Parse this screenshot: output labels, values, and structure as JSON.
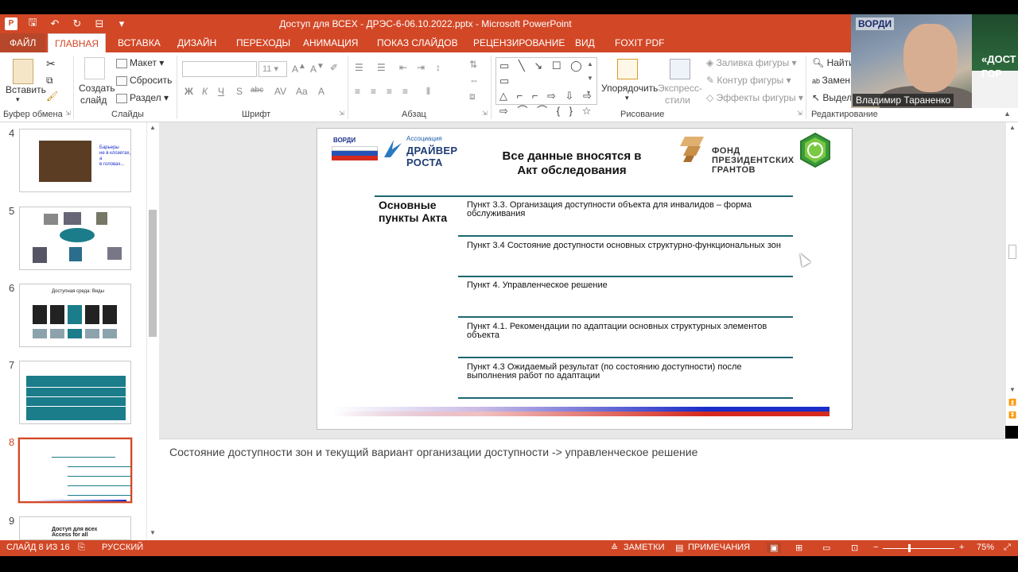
{
  "window": {
    "title": "Доступ для ВСЕХ - ДРЭС-6-06.10.2022.pptx - Microsoft PowerPoint",
    "app_logo": "P"
  },
  "quick_access": {
    "save_icon": "save-icon",
    "undo_icon": "undo-icon",
    "redo_icon": "redo-icon"
  },
  "tabs": [
    {
      "label": "ФАЙЛ"
    },
    {
      "label": "ГЛАВНАЯ"
    },
    {
      "label": "ВСТАВКА"
    },
    {
      "label": "ДИЗАЙН"
    },
    {
      "label": "ПЕРЕХОДЫ"
    },
    {
      "label": "АНИМАЦИЯ"
    },
    {
      "label": "ПОКАЗ СЛАЙДОВ"
    },
    {
      "label": "РЕЦЕНЗИРОВАНИЕ"
    },
    {
      "label": "ВИД"
    },
    {
      "label": "FOXIT PDF"
    }
  ],
  "ribbon": {
    "clipboard": {
      "paste": "Вставить",
      "label": "Буфер обмена"
    },
    "slides": {
      "new_slide_1": "Создать",
      "new_slide_2": "слайд",
      "layout": "Макет",
      "reset": "Сбросить",
      "section": "Раздел",
      "label": "Слайды"
    },
    "font": {
      "size": "11",
      "bold": "Ж",
      "italic": "К",
      "underline": "Ч",
      "strike": "S",
      "abc": "abc",
      "label": "Шрифт"
    },
    "paragraph": {
      "label": "Абзац"
    },
    "drawing": {
      "arrange": "Упорядочить",
      "quick_styles_1": "Экспресс-",
      "quick_styles_2": "стили",
      "fill": "Заливка фигуры",
      "outline": "Контур фигуры",
      "effects": "Эффекты фигуры",
      "label": "Рисование",
      "shapes_row1": "▭ ╲ ↘ ☐ ◯ ▭",
      "shapes_row2": "△ ⌐ ⌐ ⇨ ⇩ ⇨",
      "shapes_row3": "⇨ ⌒ ⌒ { } ☆"
    },
    "editing": {
      "find": "Найти",
      "replace": "Замен",
      "select": "Выдел",
      "label": "Редактирование"
    }
  },
  "webcam": {
    "sign_text": "ВОРДИ",
    "presenter_name": "Владимир Тараненко",
    "right_sign": "«ДОСТ\nГОР"
  },
  "thumbnails": [
    {
      "num": "4",
      "text": "Барьеры\nне в клозетах,\nа\nв головах..."
    },
    {
      "num": "5"
    },
    {
      "num": "6",
      "text": "Доступная среда: Виды"
    },
    {
      "num": "7"
    },
    {
      "num": "8",
      "selected": true
    },
    {
      "num": "9",
      "text": "Доступ для всех\nAccess for all"
    }
  ],
  "slide": {
    "logo_vordi": "ВОРДИ",
    "logo_driver_1": "Ассоциация",
    "logo_driver_2": "ДРАЙВЕР РОСТА",
    "title_line1": "Все данные вносятся в",
    "title_line2": "Акт обследования",
    "fund_line1": "ФОНД",
    "fund_line2": "ПРЕЗИДЕНТСКИХ",
    "fund_line3": "ГРАНТОВ",
    "act_label_1": "Основные",
    "act_label_2": "пункты Акта",
    "items": [
      {
        "line1": "Пункт 3.3. Организация доступности объекта для инвалидов – форма",
        "line2": "обслуживания"
      },
      {
        "line1": "Пункт 3.4 Состояние доступности основных структурно-функциональных зон",
        "line2": ""
      },
      {
        "line1": "Пункт 4. Управленческое решение",
        "line2": ""
      },
      {
        "line1": "Пункт 4.1. Рекомендации по адаптации основных структурных элементов",
        "line2": "объекта"
      },
      {
        "line1": "Пункт 4.3 Ожидаемый результат (по состоянию доступности) после",
        "line2": "выполнения работ по адаптации"
      }
    ]
  },
  "notes": {
    "text": "Состояние доступности зон и текущий вариант организации доступности -> управленческое решение"
  },
  "status": {
    "slide_info": "СЛАЙД 8 ИЗ 16",
    "language": "РУССКИЙ",
    "notes_btn": "ЗАМЕТКИ",
    "comments_btn": "ПРИМЕЧАНИЯ",
    "zoom": "75%"
  },
  "colors": {
    "accent": "#d24726",
    "teal": "#1d6770"
  }
}
